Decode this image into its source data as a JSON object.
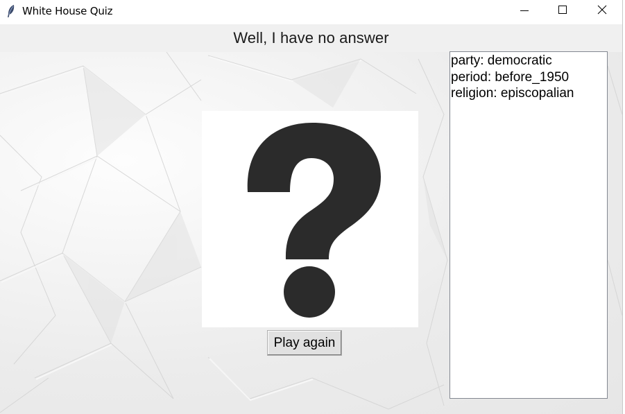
{
  "window": {
    "title": "White House Quiz",
    "icon": "feather-icon",
    "controls": [
      "minimize-icon",
      "maximize-icon",
      "close-icon"
    ]
  },
  "header": {
    "text": "Well, I have no answer"
  },
  "image": {
    "icon": "question-mark-icon",
    "color": "#2b2b2b"
  },
  "play_again": {
    "label": "Play again"
  },
  "info_panel": {
    "lines": [
      "party: democratic",
      "period: before_1950",
      "religion: episcopalian"
    ]
  },
  "colors": {
    "header_bg": "#f0f0f0",
    "button_bg": "#e1e1e1",
    "paper": "#ececec"
  }
}
